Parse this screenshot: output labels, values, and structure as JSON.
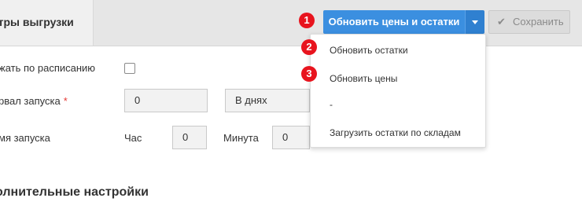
{
  "tab": {
    "label": "етры выгрузки"
  },
  "form": {
    "schedule_label": "жать по расписанию",
    "interval_label": "рвал запуска",
    "required_mark": "*",
    "interval_value": "0",
    "interval_unit": "В днях",
    "time_label": "мя запуска",
    "hour_label": "Час",
    "hour_value": "0",
    "minute_label": "Минута",
    "minute_value": "0"
  },
  "section": {
    "title": "олнительные настройки"
  },
  "toolbar": {
    "primary_label": "Обновить цены и остатки",
    "save_label": "Сохранить",
    "save_icon": "check-icon"
  },
  "dropdown": {
    "items": [
      "Обновить остатки",
      "Обновить цены",
      "-",
      "Загрузить остатки по складам"
    ]
  },
  "badges": [
    "1",
    "2",
    "3"
  ],
  "colors": {
    "primary": "#3b8fe0",
    "badge": "#e8141e",
    "required": "#e53935"
  }
}
